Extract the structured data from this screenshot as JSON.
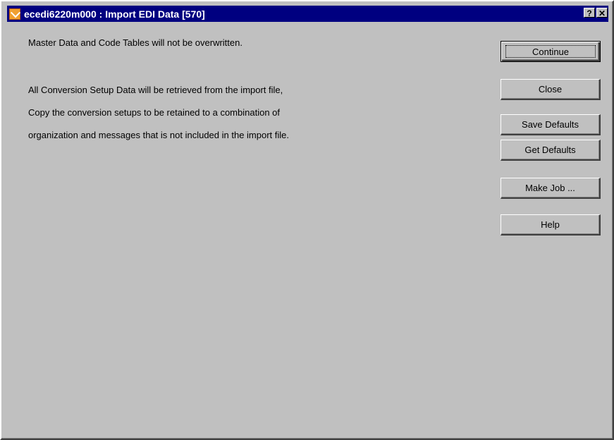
{
  "window": {
    "title": "ecedi6220m000 : Import EDI Data [570]",
    "help_button": "?",
    "close_button": "✕",
    "titlebar_color": "#000080"
  },
  "messages": [
    "Master Data and Code Tables will not be overwritten.",
    "All Conversion Setup Data will be retrieved from the import file,",
    "Copy the conversion setups to be retained to a combination of",
    "organization and messages that is not included in the import file."
  ],
  "buttons": {
    "continue": "Continue",
    "close": "Close",
    "save_defaults": "Save Defaults",
    "get_defaults": "Get Defaults",
    "make_job": "Make Job ...",
    "help": "Help"
  }
}
